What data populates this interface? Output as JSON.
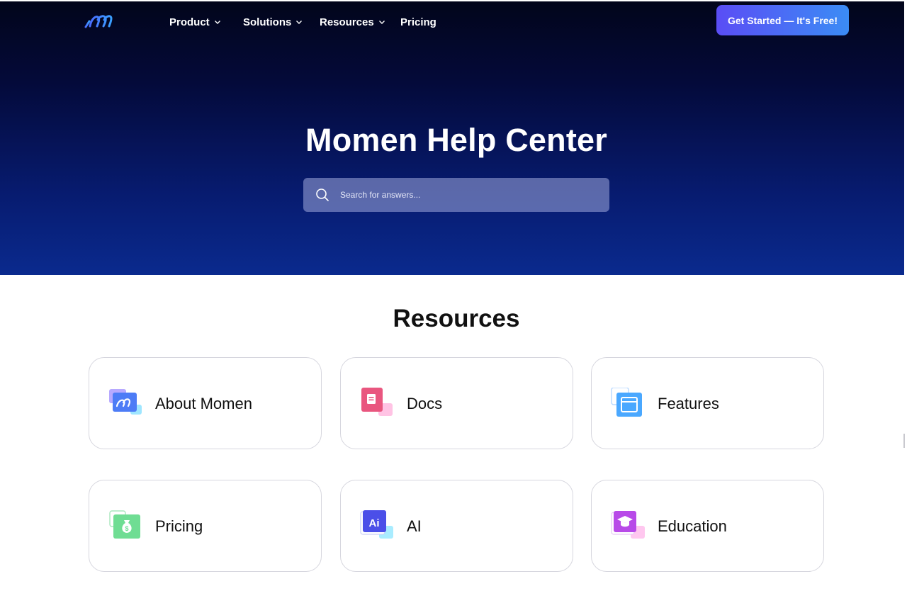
{
  "header": {
    "logo_icon": "momen-logo-icon",
    "nav": [
      {
        "label": "Product",
        "has_dropdown": true
      },
      {
        "label": "Solutions",
        "has_dropdown": true
      },
      {
        "label": "Resources",
        "has_dropdown": true
      },
      {
        "label": "Pricing",
        "has_dropdown": false
      }
    ],
    "cta_label": "Get Started — It's Free!"
  },
  "hero": {
    "title": "Momen Help Center",
    "search": {
      "placeholder": "Search for answers...",
      "value": "",
      "icon": "search-icon"
    }
  },
  "resources": {
    "title": "Resources",
    "cards": [
      {
        "label": "About Momen",
        "icon": "about-momen-icon"
      },
      {
        "label": "Docs",
        "icon": "docs-icon"
      },
      {
        "label": "Features",
        "icon": "features-icon"
      },
      {
        "label": "Pricing",
        "icon": "pricing-icon"
      },
      {
        "label": "AI",
        "icon": "ai-icon"
      },
      {
        "label": "Education",
        "icon": "education-icon"
      }
    ]
  },
  "colors": {
    "hero_top": "#02051a",
    "hero_bottom": "#0a2a8e",
    "cta_start": "#5a4df5",
    "cta_end": "#3b8cf5"
  }
}
